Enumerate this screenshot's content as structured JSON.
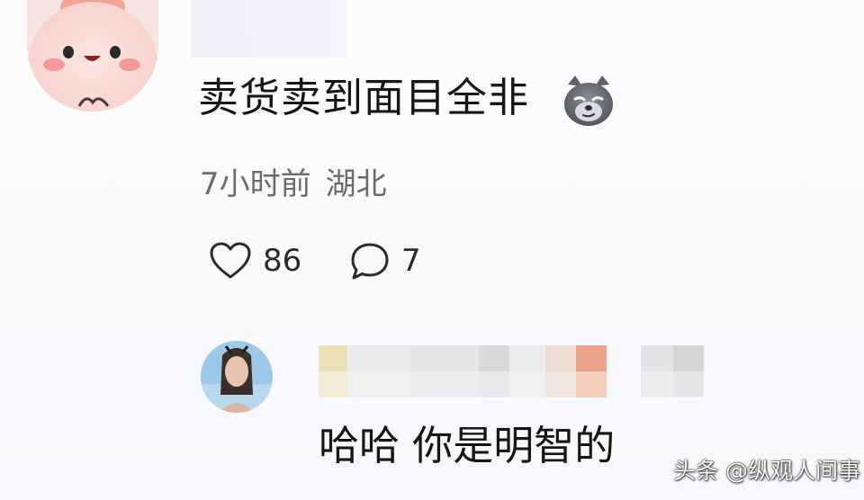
{
  "comment": {
    "text": "卖货卖到面目全非",
    "emoji_icon": "smirk-dog-emoji-icon",
    "meta_time": "7小时前",
    "meta_location": "湖北",
    "likes_count": "86",
    "replies_count": "7"
  },
  "reply": {
    "text": "哈哈 你是明智的"
  },
  "watermark": {
    "text": "头条 @纵观人间事"
  },
  "colors": {
    "background": "#fbfbfd",
    "text_primary": "#161616",
    "text_meta": "#6b6b6b",
    "avatar_main_skin": "#f8d6d0",
    "avatar_main_cheek": "#f08a8a",
    "reply_avatar_bg": "#9cc9e8"
  }
}
